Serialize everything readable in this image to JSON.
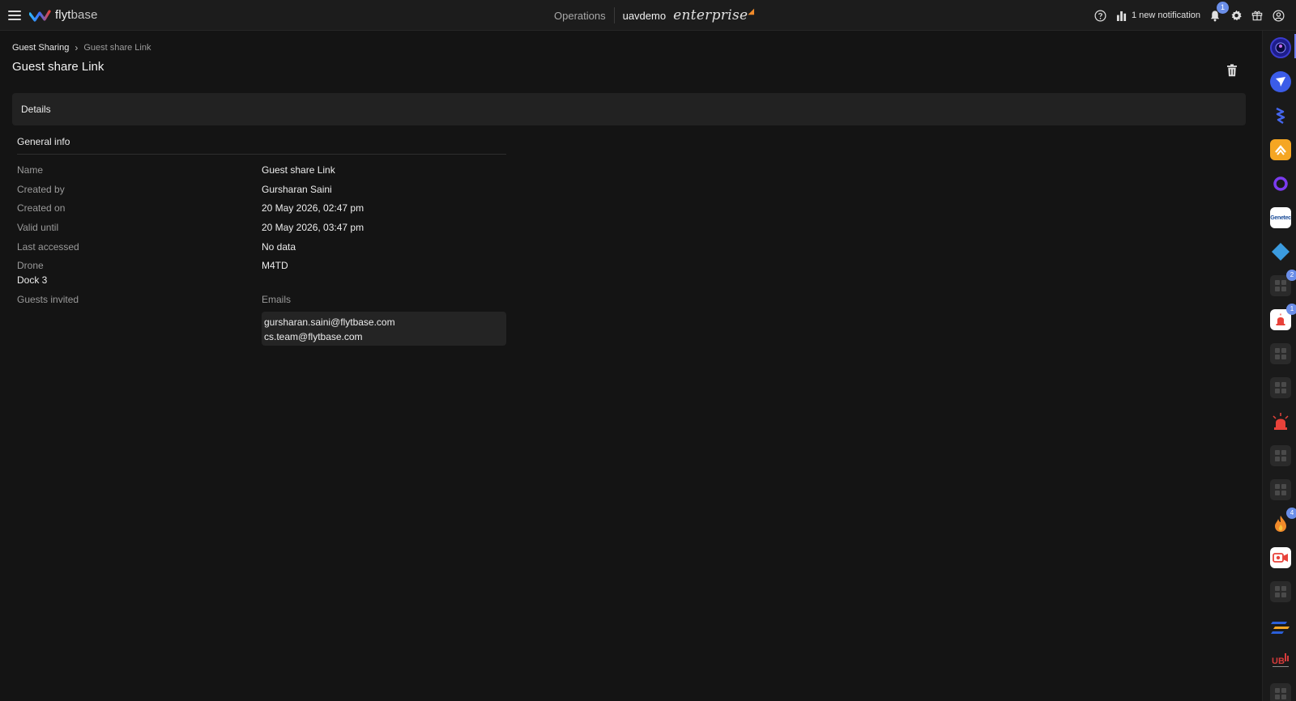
{
  "topbar": {
    "logo_text_bold": "flyt",
    "logo_text_light": "base",
    "nav_operations": "Operations",
    "org_name": "uavdemo",
    "plan_name": "enterprise",
    "notification_text": "1 new notification",
    "notification_count": "1"
  },
  "breadcrumb": {
    "parent": "Guest Sharing",
    "separator": "›",
    "current": "Guest share Link"
  },
  "page": {
    "title": "Guest share Link",
    "section_header": "Details",
    "subsection": "General info"
  },
  "details": {
    "rows": [
      {
        "label": "Name",
        "value": "Guest share Link"
      },
      {
        "label": "Created by",
        "value": "Gursharan Saini"
      },
      {
        "label": "Created on",
        "value": "20 May 2026, 02:47 pm"
      },
      {
        "label": "Valid until",
        "value": "20 May 2026, 03:47 pm"
      },
      {
        "label": "Last accessed",
        "value": "No data"
      },
      {
        "label": "Drone",
        "value": "M4TD"
      }
    ],
    "dock": "Dock 3",
    "guests_label": "Guests invited",
    "emails_label": "Emails",
    "emails": [
      "gursharan.saini@flytbase.com",
      "cs.team@flytbase.com"
    ]
  },
  "rail": {
    "badges": [
      "2",
      "1",
      "4"
    ],
    "genetec_label": "Genetec"
  },
  "colors": {
    "background": "#141414",
    "topbar": "#1c1c1c",
    "panel": "#222222",
    "badge": "#6a8ee8",
    "plan_accent": "#f08a2a"
  },
  "icons": {
    "menu": "hamburger-icon",
    "help": "help-circle-icon",
    "stats": "bar-chart-icon",
    "bell": "bell-icon",
    "settings": "gear-icon",
    "gift": "gift-icon",
    "account": "user-circle-icon",
    "delete": "trash-icon"
  }
}
